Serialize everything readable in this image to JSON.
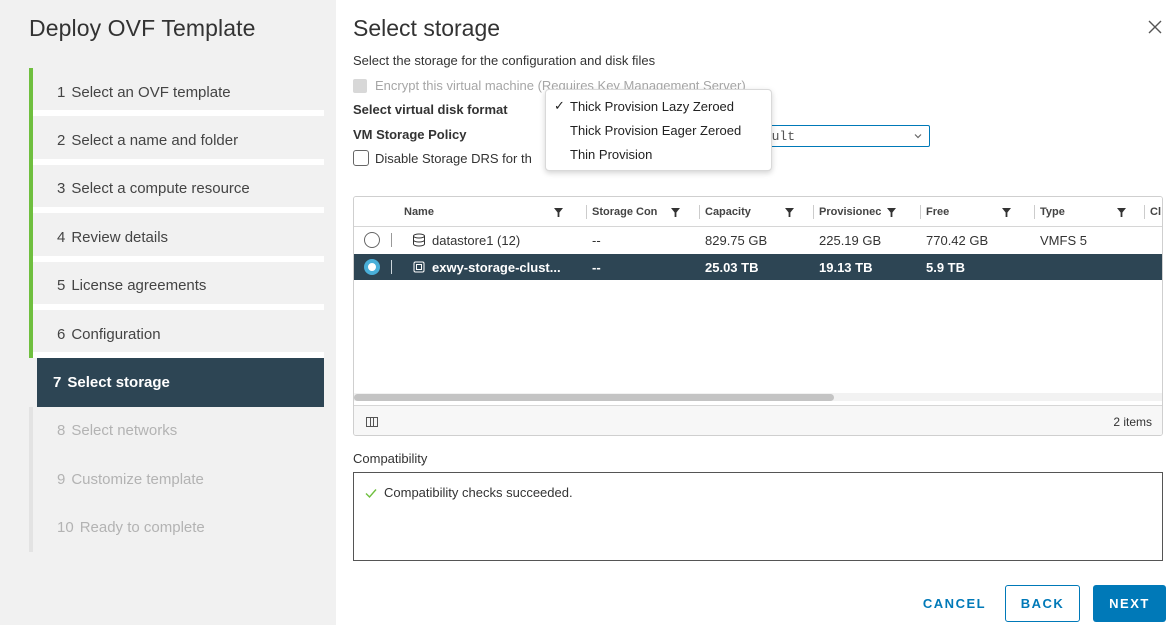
{
  "wizard": {
    "title": "Deploy OVF Template",
    "steps": [
      {
        "num": "1",
        "label": "Select an OVF template",
        "state": "done"
      },
      {
        "num": "2",
        "label": "Select a name and folder",
        "state": "done"
      },
      {
        "num": "3",
        "label": "Select a compute resource",
        "state": "done"
      },
      {
        "num": "4",
        "label": "Review details",
        "state": "done"
      },
      {
        "num": "5",
        "label": "License agreements",
        "state": "done"
      },
      {
        "num": "6",
        "label": "Configuration",
        "state": "done"
      },
      {
        "num": "7",
        "label": "Select storage",
        "state": "active"
      },
      {
        "num": "8",
        "label": "Select networks",
        "state": "future"
      },
      {
        "num": "9",
        "label": "Customize template",
        "state": "future"
      },
      {
        "num": "10",
        "label": "Ready to complete",
        "state": "future"
      }
    ]
  },
  "page": {
    "title": "Select storage",
    "subtitle": "Select the storage for the configuration and disk files",
    "encrypt_label": "Encrypt this virtual machine (Requires Key Management Server)",
    "disk_format_label": "Select virtual disk format",
    "policy_label": "VM Storage Policy",
    "policy_value": "fault",
    "drs_label": "Disable Storage DRS for th"
  },
  "disk_format_menu": {
    "options": [
      {
        "label": "Thick Provision Lazy Zeroed",
        "checked": true
      },
      {
        "label": "Thick Provision Eager Zeroed",
        "checked": false
      },
      {
        "label": "Thin Provision",
        "checked": false
      }
    ]
  },
  "grid": {
    "columns": [
      "Name",
      "Storage Con",
      "Capacity",
      "Provisionec",
      "Free",
      "Type",
      "Cl"
    ],
    "rows": [
      {
        "name": "datastore1 (12)",
        "storage": "--",
        "capacity": "829.75 GB",
        "provisioned": "225.19 GB",
        "free": "770.42 GB",
        "type": "VMFS 5",
        "selected": false
      },
      {
        "name": "exwy-storage-clust...",
        "storage": "--",
        "capacity": "25.03 TB",
        "provisioned": "19.13 TB",
        "free": "5.9 TB",
        "type": "",
        "selected": true
      }
    ],
    "item_count": "2 items"
  },
  "compatibility": {
    "label": "Compatibility",
    "message": "Compatibility checks succeeded."
  },
  "buttons": {
    "cancel": "CANCEL",
    "back": "BACK",
    "next": "NEXT"
  },
  "colors": {
    "accent": "#0079b8",
    "selected_row": "#2d4554",
    "progress_green": "#6fbf3f"
  }
}
